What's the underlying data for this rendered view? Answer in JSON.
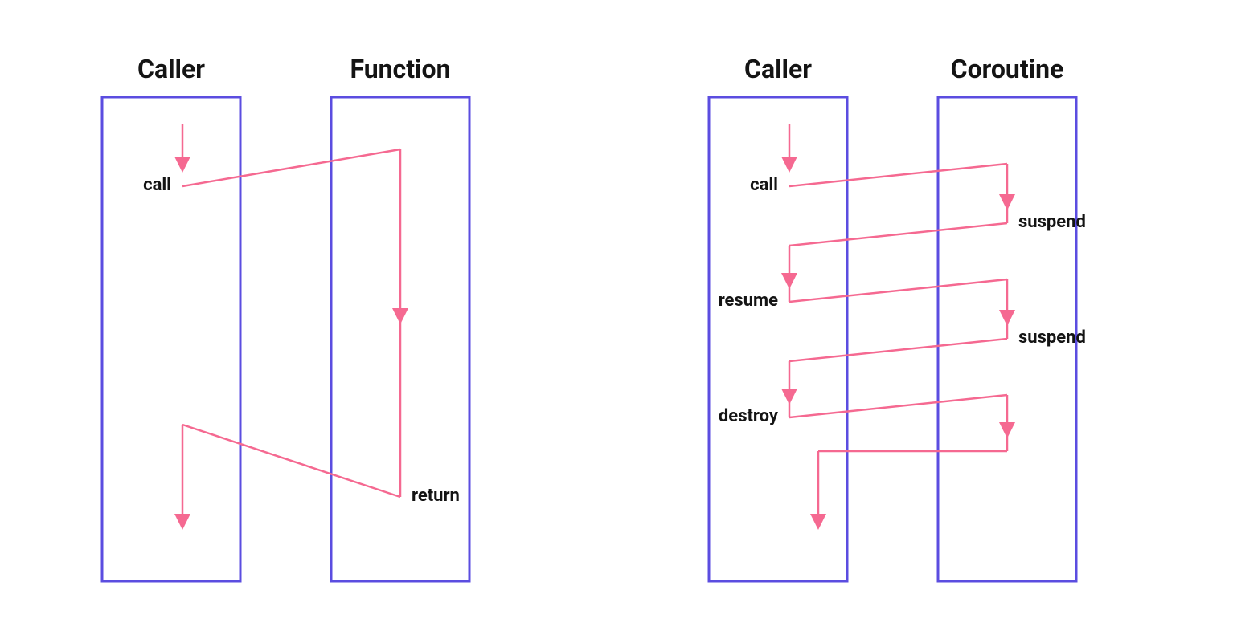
{
  "colors": {
    "box_stroke": "#5b4de0",
    "flow": "#f56991",
    "text": "#141414",
    "bg": "#ffffff"
  },
  "left": {
    "caller_header": "Caller",
    "callee_header": "Function",
    "labels": {
      "call": "call",
      "return": "return"
    }
  },
  "right": {
    "caller_header": "Caller",
    "callee_header": "Coroutine",
    "labels": {
      "call": "call",
      "suspend1": "suspend",
      "resume": "resume",
      "suspend2": "suspend",
      "destroy": "destroy"
    }
  }
}
